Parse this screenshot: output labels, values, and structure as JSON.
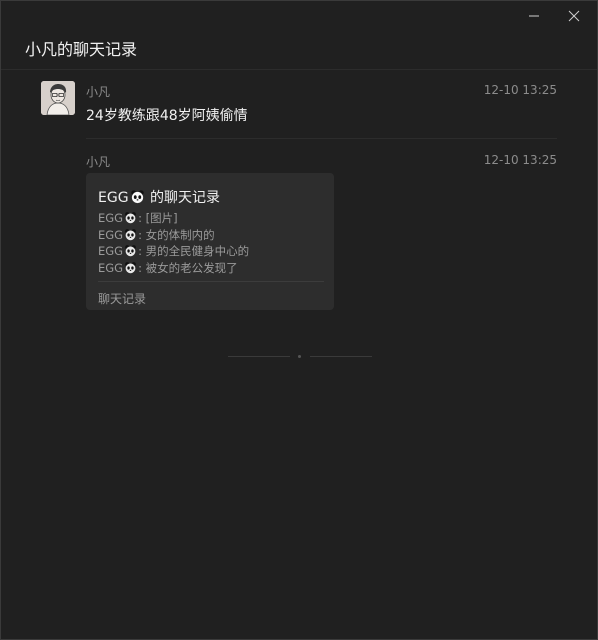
{
  "window": {
    "title": "小凡的聊天记录",
    "minimize_icon": "minimize-icon",
    "close_icon": "close-icon"
  },
  "messages": [
    {
      "sender": "小凡",
      "time": "12-10 13:25",
      "text": "24岁教练跟48岁阿姨偷情"
    },
    {
      "sender": "小凡",
      "time": "12-10 13:25",
      "card": {
        "title_prefix": "EGG",
        "title_suffix": " 的聊天记录",
        "lines": [
          {
            "name": "EGG",
            "text": ": [图片]"
          },
          {
            "name": "EGG",
            "text": ": 女的体制内的"
          },
          {
            "name": "EGG",
            "text": ": 男的全民健身中心的"
          },
          {
            "name": "EGG",
            "text": ": 被女的老公发现了"
          }
        ],
        "footer": "聊天记录"
      }
    }
  ],
  "colors": {
    "background": "#202020",
    "card": "#2d2d2d",
    "muted_text": "#8c8c8c"
  }
}
